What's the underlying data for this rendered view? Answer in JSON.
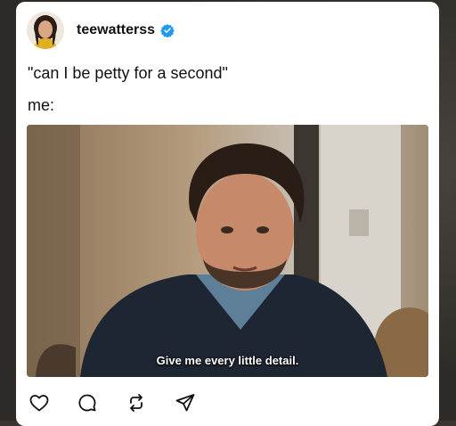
{
  "post": {
    "username": "teewatterss",
    "verified": true,
    "lines": [
      "\"can I be petty for a second\"",
      "me:"
    ],
    "media": {
      "subtitle": "Give me every little detail."
    }
  },
  "actions": {
    "icons": [
      "heart-icon",
      "comment-icon",
      "repost-icon",
      "share-icon"
    ]
  },
  "colors": {
    "verified_blue": "#1d9bf0",
    "text": "#111111",
    "card_bg": "#ffffff"
  }
}
